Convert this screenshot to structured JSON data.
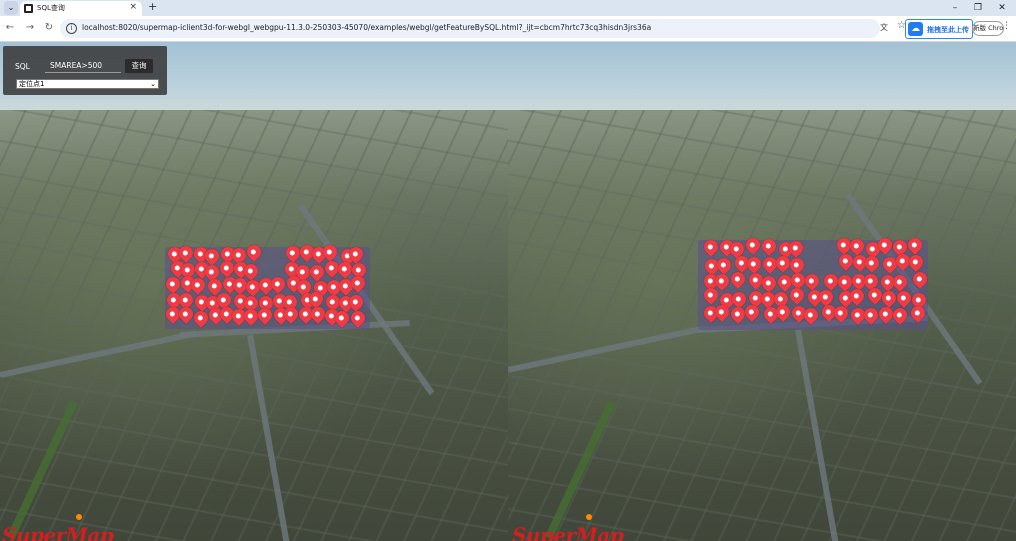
{
  "browser": {
    "tab_title": "SQL查询",
    "tab_close": "×",
    "new_tab": "+",
    "url": "localhost:8020/supermap-iclient3d-for-webgl_webgpu-11.3.0-250303-45070/examples/webgl/getFeatureBySQL.html?_ijt=cbcm7hrtc73cq3hisdn3jrs36a",
    "extension_label": "拖拽至此上传",
    "update_label": "新版 Chrome 可更新",
    "window_minimize": "–",
    "window_maximize": "❐",
    "window_close": "✕"
  },
  "sql_panel": {
    "label": "SQL",
    "query_value": "SMAREA>500",
    "query_button": "查询",
    "location_selected": "定位点1"
  },
  "scene": {
    "logo_text": "SuperMap",
    "marker_color": "#ef3b45"
  },
  "icons": {
    "back": "back-arrow-icon",
    "forward": "forward-arrow-icon",
    "reload": "reload-icon",
    "info": "info-icon",
    "translate": "translate-icon",
    "star": "bookmark-star-icon",
    "menu": "kebab-menu-icon"
  }
}
